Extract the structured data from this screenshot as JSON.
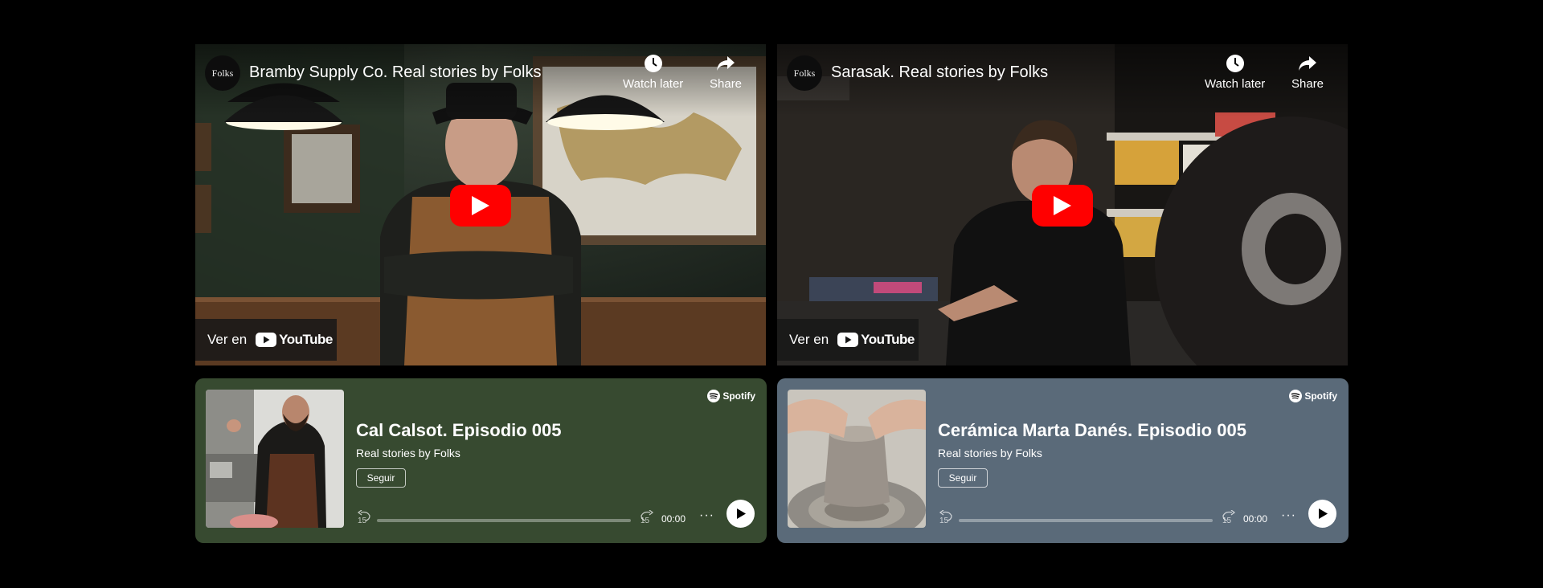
{
  "colors": {
    "page_background": "#000000",
    "youtube_red": "#ff0000",
    "podcast1_background": "#374a30",
    "podcast2_background": "#5a6a79"
  },
  "videos": [
    {
      "channel_avatar_text": "Folks",
      "title": "Bramby Supply Co. Real stories by Folks",
      "watch_later_label": "Watch later",
      "share_label": "Share",
      "watch_on_label": "Ver en",
      "youtube_wordmark": "YouTube",
      "icons": [
        "clock-icon",
        "share-arrow-icon",
        "play-icon",
        "youtube-logo-icon"
      ]
    },
    {
      "channel_avatar_text": "Folks",
      "title": "Sarasak. Real stories by Folks",
      "watch_later_label": "Watch later",
      "share_label": "Share",
      "watch_on_label": "Ver en",
      "youtube_wordmark": "YouTube",
      "icons": [
        "clock-icon",
        "share-arrow-icon",
        "play-icon",
        "youtube-logo-icon"
      ]
    }
  ],
  "podcasts": [
    {
      "brand": "Spotify",
      "title": "Cal Calsot. Episodio 005",
      "subtitle": "Real stories by Folks",
      "follow_label": "Seguir",
      "skip_back_seconds": "15",
      "skip_forward_seconds": "15",
      "time": "00:00",
      "progress": 0,
      "more_label": "···",
      "background": "#374a30"
    },
    {
      "brand": "Spotify",
      "title": "Cerámica Marta Danés. Episodio 005",
      "subtitle": "Real stories by Folks",
      "follow_label": "Seguir",
      "skip_back_seconds": "15",
      "skip_forward_seconds": "15",
      "time": "00:00",
      "progress": 0,
      "more_label": "···",
      "background": "#5a6a79"
    }
  ]
}
